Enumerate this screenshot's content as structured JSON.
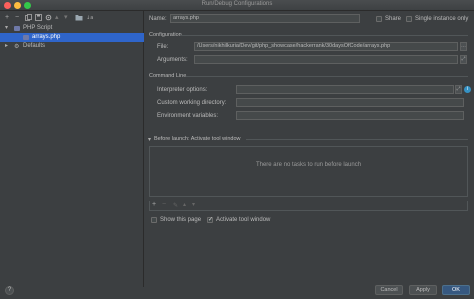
{
  "window": {
    "title": "Run/Debug Configurations"
  },
  "colors": {
    "selection": "#2f65ca",
    "primary_button": "#365880",
    "background": "#3c3f41"
  },
  "toolbar": {
    "icons": [
      "add-icon",
      "remove-icon",
      "copy-icon",
      "save-icon",
      "settings-icon",
      "move-up-icon",
      "move-down-icon",
      "folder-icon",
      "sort-icon"
    ]
  },
  "tree": {
    "php_script": "PHP Script",
    "arrays_php": "arrays.php",
    "defaults": "Defaults"
  },
  "form": {
    "name_label": "Name:",
    "name_value": "arrays.php",
    "share_label": "Share",
    "single_instance_label": "Single instance only",
    "configuration_section": "Configuration",
    "file_label": "File:",
    "file_value": "/Users/nikhilkuria/Dev/git/php_showcase/hackerrank/30daysOfCode/arrays.php",
    "arguments_label": "Arguments:",
    "command_line_section": "Command Line",
    "interpreter_label": "Interpreter options:",
    "working_dir_label": "Custom working directory:",
    "env_vars_label": "Environment variables:"
  },
  "before_launch": {
    "header": "Before launch: Activate tool window",
    "empty_text": "There are no tasks to run before launch",
    "show_page_label": "Show this page",
    "activate_tool_label": "Activate tool window"
  },
  "footer": {
    "help": "?",
    "cancel": "Cancel",
    "apply": "Apply",
    "ok": "OK"
  }
}
